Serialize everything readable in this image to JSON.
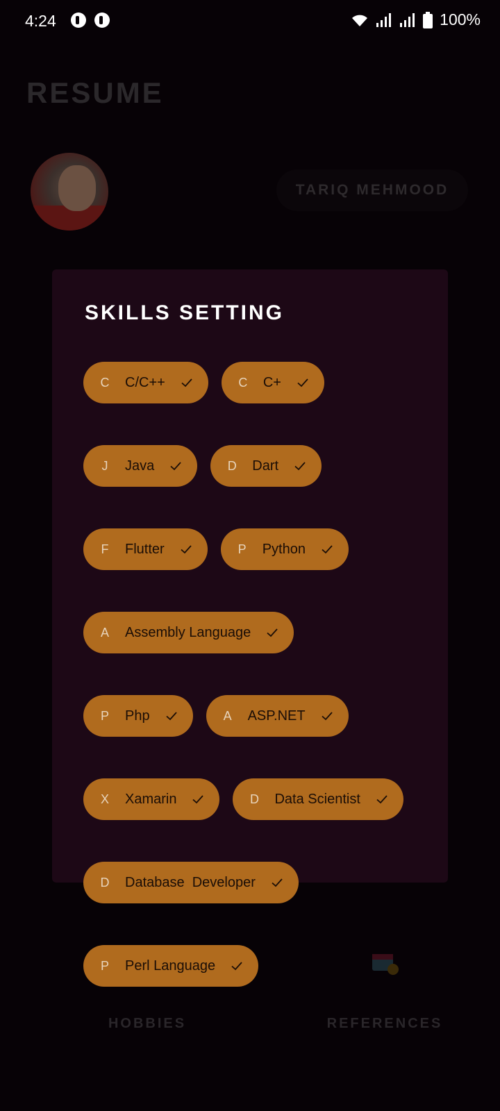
{
  "status_bar": {
    "time": "4:24",
    "battery": "100%"
  },
  "background_page": {
    "title": "RESUME",
    "name": "TARIQ MEHMOOD",
    "nav": [
      {
        "label": "HOBBIES",
        "icon": "hobbies-icon"
      },
      {
        "label": "REFERENCES",
        "icon": "references-icon"
      }
    ]
  },
  "dialog": {
    "title": "SKILLS SETTING",
    "chips": [
      {
        "letter": "C",
        "label": "C/C++"
      },
      {
        "letter": "C",
        "label": "C+"
      },
      {
        "letter": "J",
        "label": "Java"
      },
      {
        "letter": "D",
        "label": "Dart"
      },
      {
        "letter": "F",
        "label": "Flutter"
      },
      {
        "letter": "P",
        "label": "Python"
      },
      {
        "letter": "A",
        "label": "Assembly Language"
      },
      {
        "letter": "P",
        "label": "Php"
      },
      {
        "letter": "A",
        "label": "ASP.NET"
      },
      {
        "letter": "X",
        "label": "Xamarin"
      },
      {
        "letter": "D",
        "label": "Data Scientist"
      },
      {
        "letter": "D",
        "label": "Database  Developer"
      },
      {
        "letter": "P",
        "label": "Perl Language"
      }
    ]
  },
  "colors": {
    "chip_bg": "#b06b1e",
    "dialog_bg": "#1d0816",
    "page_bg": "#070206"
  }
}
